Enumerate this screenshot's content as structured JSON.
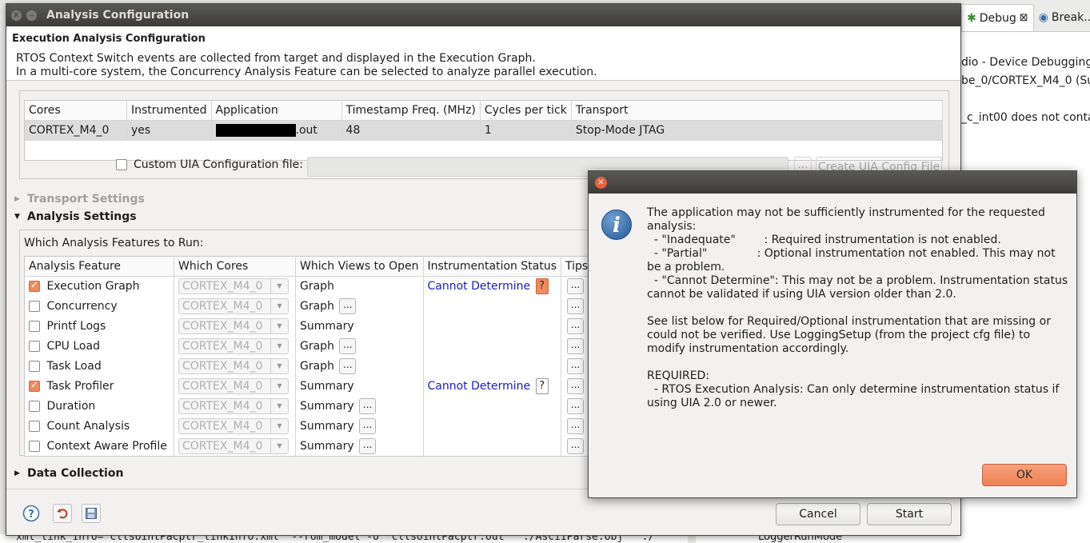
{
  "background": {
    "tabs": [
      {
        "label": "Debug",
        "active": true,
        "close": "⊠"
      },
      {
        "label": "Break...",
        "active": false
      }
    ],
    "lines": [
      "dio - Device Debugging]",
      "be_0/CORTEX_M4_0 (Su",
      "_c_int00 does not conta"
    ],
    "bottom_left_text": "xml_link_info=\"cllsointPacptr_linkInfo.xml\" --rom_model -o \"cllsointPacptr.out\" \"./AsciiParse.obj\" \"./",
    "bottom_right_text": "LoggerRunMode"
  },
  "dialog": {
    "title": "Analysis Configuration",
    "header_title": "Execution Analysis Configuration",
    "header_desc_1": "RTOS Context Switch events are collected from target and displayed in the Execution Graph.",
    "header_desc_2": "In a multi-core system, the Concurrency Analysis Feature can be selected to analyze parallel execution.",
    "cores_table": {
      "headers": [
        "Cores",
        "Instrumented",
        "Application",
        "Timestamp Freq. (MHz)",
        "Cycles per tick",
        "Transport"
      ],
      "row": {
        "core": "CORTEX_M4_0",
        "instrumented": "yes",
        "app_suffix": ".out",
        "freq": "48",
        "cycles": "1",
        "transport": "Stop-Mode JTAG"
      }
    },
    "custom_uia_label": "Custom UIA Configuration file:",
    "custom_uia_dots": "...",
    "create_uia_label": "Create UIA Config File",
    "transport_settings": "Transport Settings",
    "analysis_settings": "Analysis Settings",
    "features_prompt": "Which Analysis Features to Run:",
    "features_table": {
      "headers": [
        "Analysis Feature",
        "Which Cores",
        "Which Views to Open",
        "Instrumentation Status",
        "Tips"
      ],
      "rows": [
        {
          "name": "Execution Graph",
          "checked": true,
          "cores": "CORTEX_M4_0",
          "view": "Graph",
          "view_dots": false,
          "status": "Cannot Determine",
          "status_warn": true
        },
        {
          "name": "Concurrency",
          "checked": false,
          "cores": "CORTEX_M4_0",
          "view": "Graph",
          "view_dots": true,
          "status": "",
          "status_warn": false
        },
        {
          "name": "Printf Logs",
          "checked": false,
          "cores": "CORTEX_M4_0",
          "view": "Summary",
          "view_dots": false,
          "status": "",
          "status_warn": false
        },
        {
          "name": "CPU Load",
          "checked": false,
          "cores": "CORTEX_M4_0",
          "view": "Graph",
          "view_dots": true,
          "status": "",
          "status_warn": false
        },
        {
          "name": "Task Load",
          "checked": false,
          "cores": "CORTEX_M4_0",
          "view": "Graph",
          "view_dots": true,
          "status": "",
          "status_warn": false
        },
        {
          "name": "Task Profiler",
          "checked": true,
          "cores": "CORTEX_M4_0",
          "view": "Summary",
          "view_dots": false,
          "status": "Cannot Determine",
          "status_warn": false
        },
        {
          "name": "Duration",
          "checked": false,
          "cores": "CORTEX_M4_0",
          "view": "Summary",
          "view_dots": true,
          "status": "",
          "status_warn": false
        },
        {
          "name": "Count Analysis",
          "checked": false,
          "cores": "CORTEX_M4_0",
          "view": "Summary",
          "view_dots": true,
          "status": "",
          "status_warn": false
        },
        {
          "name": "Context Aware Profile",
          "checked": false,
          "cores": "CORTEX_M4_0",
          "view": "Summary",
          "view_dots": true,
          "status": "",
          "status_warn": false
        }
      ],
      "dots": "...",
      "q": "?"
    },
    "data_collection": "Data Collection",
    "cancel_label": "Cancel",
    "start_label": "Start"
  },
  "popup": {
    "icon": "i",
    "message": [
      "The application may not be sufficiently instrumented for the requested analysis:",
      "  - \"Inadequate\"        : Required instrumentation is not enabled.",
      "  - \"Partial\"              : Optional instrumentation not enabled. This may not be a problem.",
      "  - \"Cannot Determine\": This may not be a problem. Instrumentation status cannot be validated if using UIA version older than 2.0.",
      "",
      "See list below for Required/Optional instrumentation that are missing or could not be verified. Use LoggingSetup (from the project cfg file) to modify instrumentation accordingly.",
      "",
      "REQUIRED:",
      "  - RTOS Execution Analysis: Can only determine instrumentation status if using UIA 2.0 or newer."
    ],
    "ok_label": "OK"
  }
}
